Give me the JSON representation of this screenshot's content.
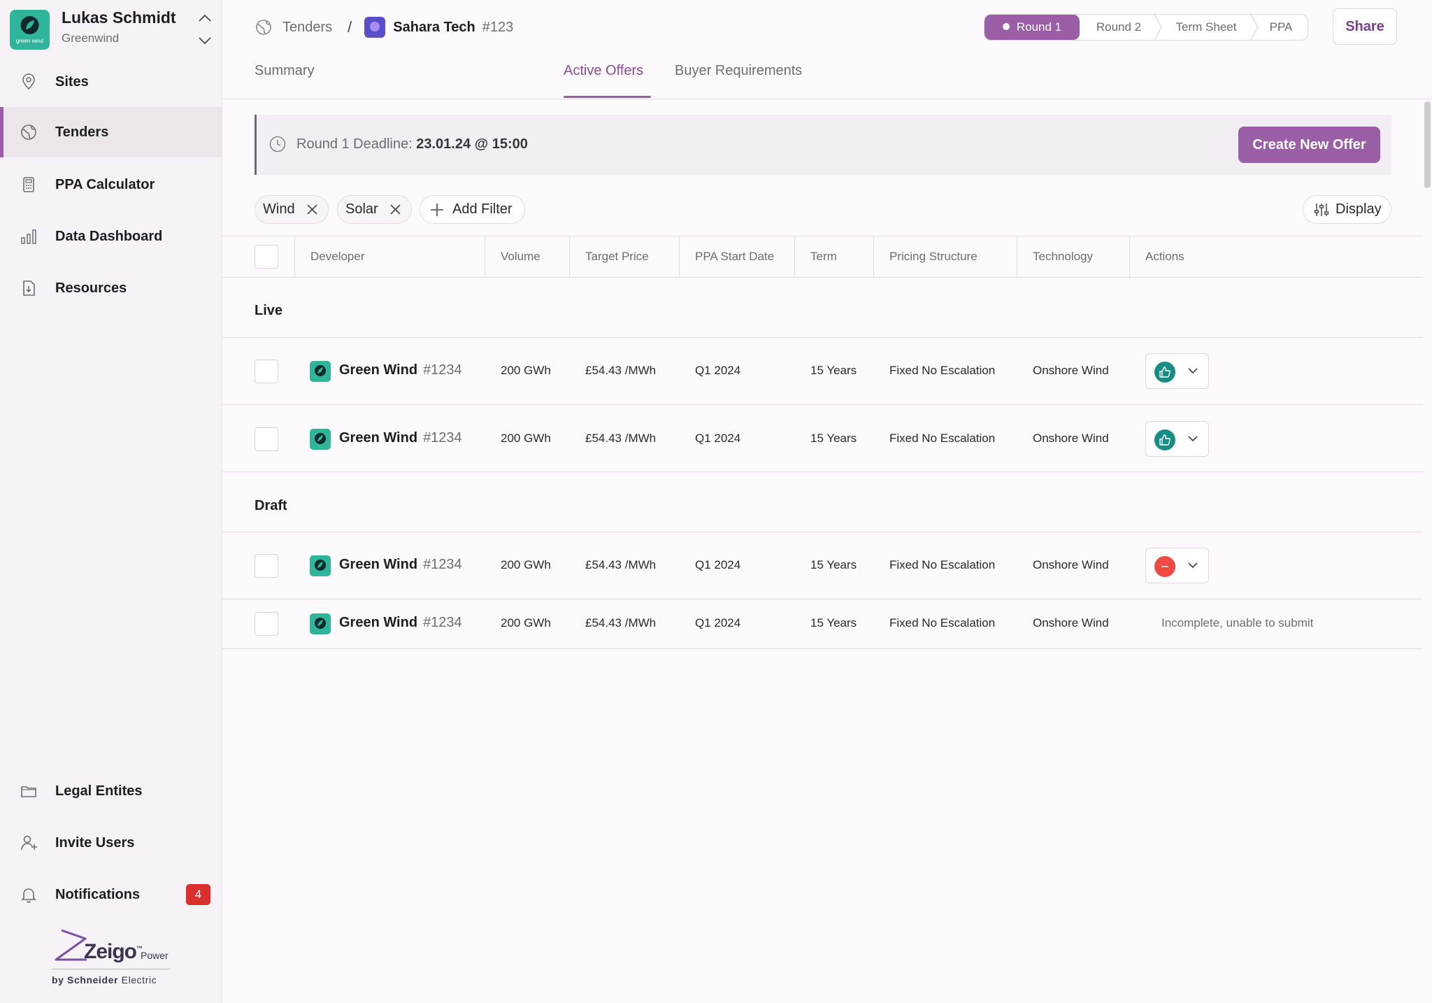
{
  "profile": {
    "name": "Lukas Schmidt",
    "org": "Greenwind",
    "logo_text": "green wind"
  },
  "sidebar": {
    "items": [
      {
        "label": "Sites",
        "icon": "location-pin-icon"
      },
      {
        "label": "Tenders",
        "icon": "globe-icon",
        "active": true
      },
      {
        "label": "PPA Calculator",
        "icon": "calculator-icon"
      },
      {
        "label": "Data Dashboard",
        "icon": "bar-chart-icon"
      },
      {
        "label": "Resources",
        "icon": "file-download-icon"
      }
    ],
    "bottom_items": [
      {
        "label": "Legal Entites",
        "icon": "folder-icon"
      },
      {
        "label": "Invite Users",
        "icon": "user-plus-icon"
      },
      {
        "label": "Notifications",
        "icon": "bell-icon",
        "badge": "4"
      }
    ],
    "brand": {
      "word": "Zeigo",
      "tm": "™",
      "sub": "Power",
      "by": "by",
      "company": "Schneider",
      "company_suffix": "Electric"
    }
  },
  "breadcrumb": {
    "parent": "Tenders",
    "current": "Sahara Tech",
    "id": "#123"
  },
  "stepper": {
    "steps": [
      "Round 1",
      "Round 2",
      "Term Sheet",
      "PPA"
    ],
    "active_index": 0
  },
  "share_label": "Share",
  "tabs": [
    {
      "label": "Summary"
    },
    {
      "label": "Active Offers",
      "active": true
    },
    {
      "label": "Buyer Requirements"
    }
  ],
  "banner": {
    "label": "Round 1 Deadline:",
    "value": "23.01.24 @ 15:00",
    "button": "Create New Offer"
  },
  "filters": {
    "chips": [
      "Wind",
      "Solar"
    ],
    "add_label": "Add Filter",
    "display_label": "Display"
  },
  "table": {
    "columns": [
      "Developer",
      "Volume",
      "Target Price",
      "PPA Start Date",
      "Term",
      "Pricing Structure",
      "Technology",
      "Actions"
    ],
    "groups": [
      {
        "label": "Live",
        "rows": [
          {
            "developer": "Green Wind",
            "id": "#1234",
            "volume": "200 GWh",
            "price": "£54.43 /MWh",
            "start": "Q1 2024",
            "term": "15 Years",
            "pricing": "Fixed No Escalation",
            "technology": "Onshore Wind",
            "action": "approve"
          },
          {
            "developer": "Green Wind",
            "id": "#1234",
            "volume": "200 GWh",
            "price": "£54.43 /MWh",
            "start": "Q1 2024",
            "term": "15 Years",
            "pricing": "Fixed No Escalation",
            "technology": "Onshore Wind",
            "action": "approve"
          }
        ]
      },
      {
        "label": "Draft",
        "rows": [
          {
            "developer": "Green Wind",
            "id": "#1234",
            "volume": "200 GWh",
            "price": "£54.43 /MWh",
            "start": "Q1 2024",
            "term": "15 Years",
            "pricing": "Fixed No Escalation",
            "technology": "Onshore Wind",
            "action": "reject"
          },
          {
            "developer": "Green Wind",
            "id": "#1234",
            "volume": "200 GWh",
            "price": "£54.43 /MWh",
            "start": "Q1 2024",
            "term": "15 Years",
            "pricing": "Fixed No Escalation",
            "technology": "Onshore Wind",
            "action_note": "Incomplete, unable to submit"
          }
        ]
      }
    ]
  },
  "colors": {
    "accent": "#9a5ea6",
    "brand_green": "#2fb59a",
    "approve": "#168e84",
    "reject": "#ef4b42",
    "badge": "#d9302e"
  }
}
